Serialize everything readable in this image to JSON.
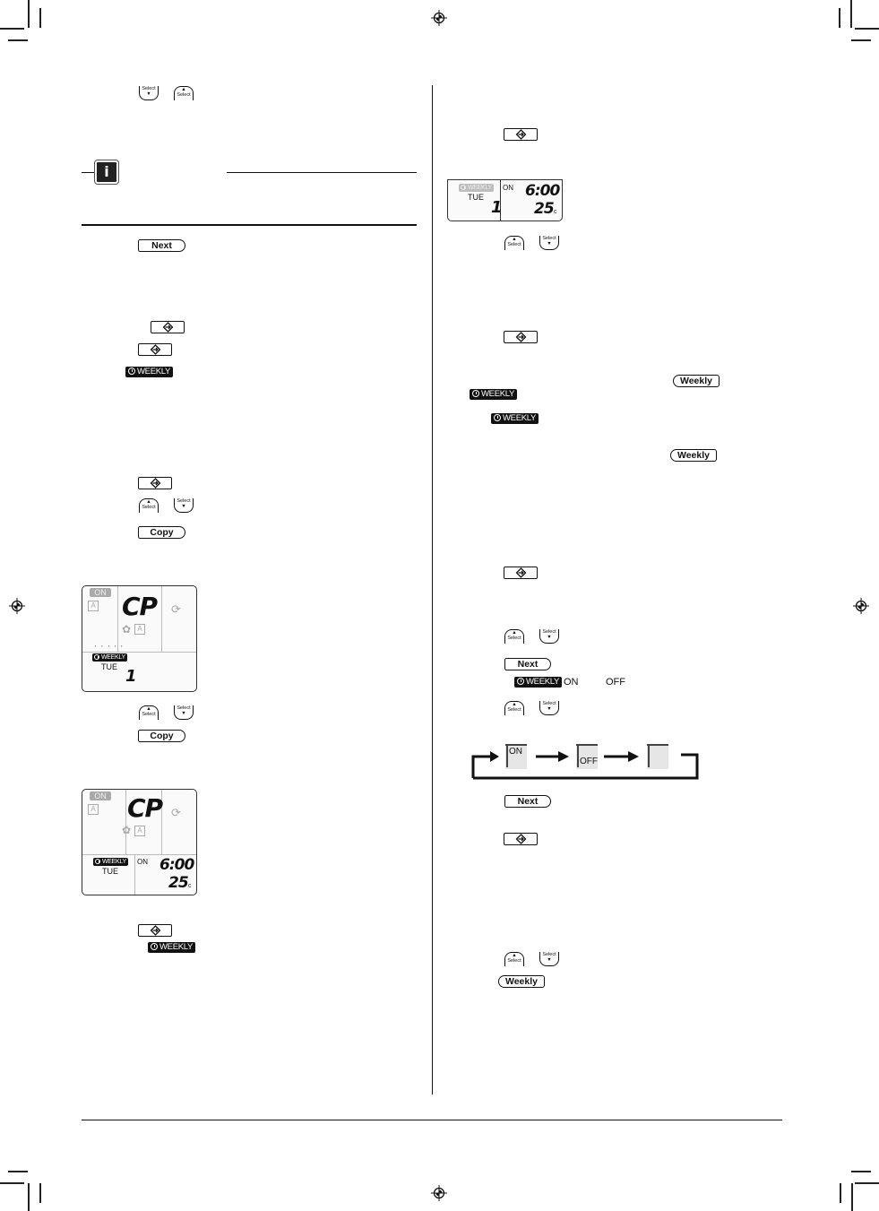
{
  "buttons": {
    "select_label": "Select",
    "next_label": "Next",
    "copy_label": "Copy",
    "weekly_label": "Weekly",
    "enter_icon": "enter-diamond-icon"
  },
  "badges": {
    "weekly": "WEEKLY"
  },
  "info": {
    "icon": "i"
  },
  "lcd_copy": {
    "on_label": "ON",
    "mode_icon": "A",
    "code": "CP",
    "day": "TUE",
    "program_number": "1"
  },
  "lcd_copy_set": {
    "on_label": "ON",
    "mode_icon": "A",
    "code": "CP",
    "day": "TUE",
    "action": "ON",
    "time": "6:00",
    "temp": "25",
    "temp_unit": "c"
  },
  "lcd_program": {
    "day": "TUE",
    "program_number": "1",
    "action": "ON",
    "time": "6:00",
    "temp": "25",
    "temp_unit": "c"
  },
  "action_line": {
    "on": "ON",
    "off": "OFF"
  },
  "cycle_diagram": {
    "states": [
      "ON",
      "OFF",
      ""
    ]
  }
}
